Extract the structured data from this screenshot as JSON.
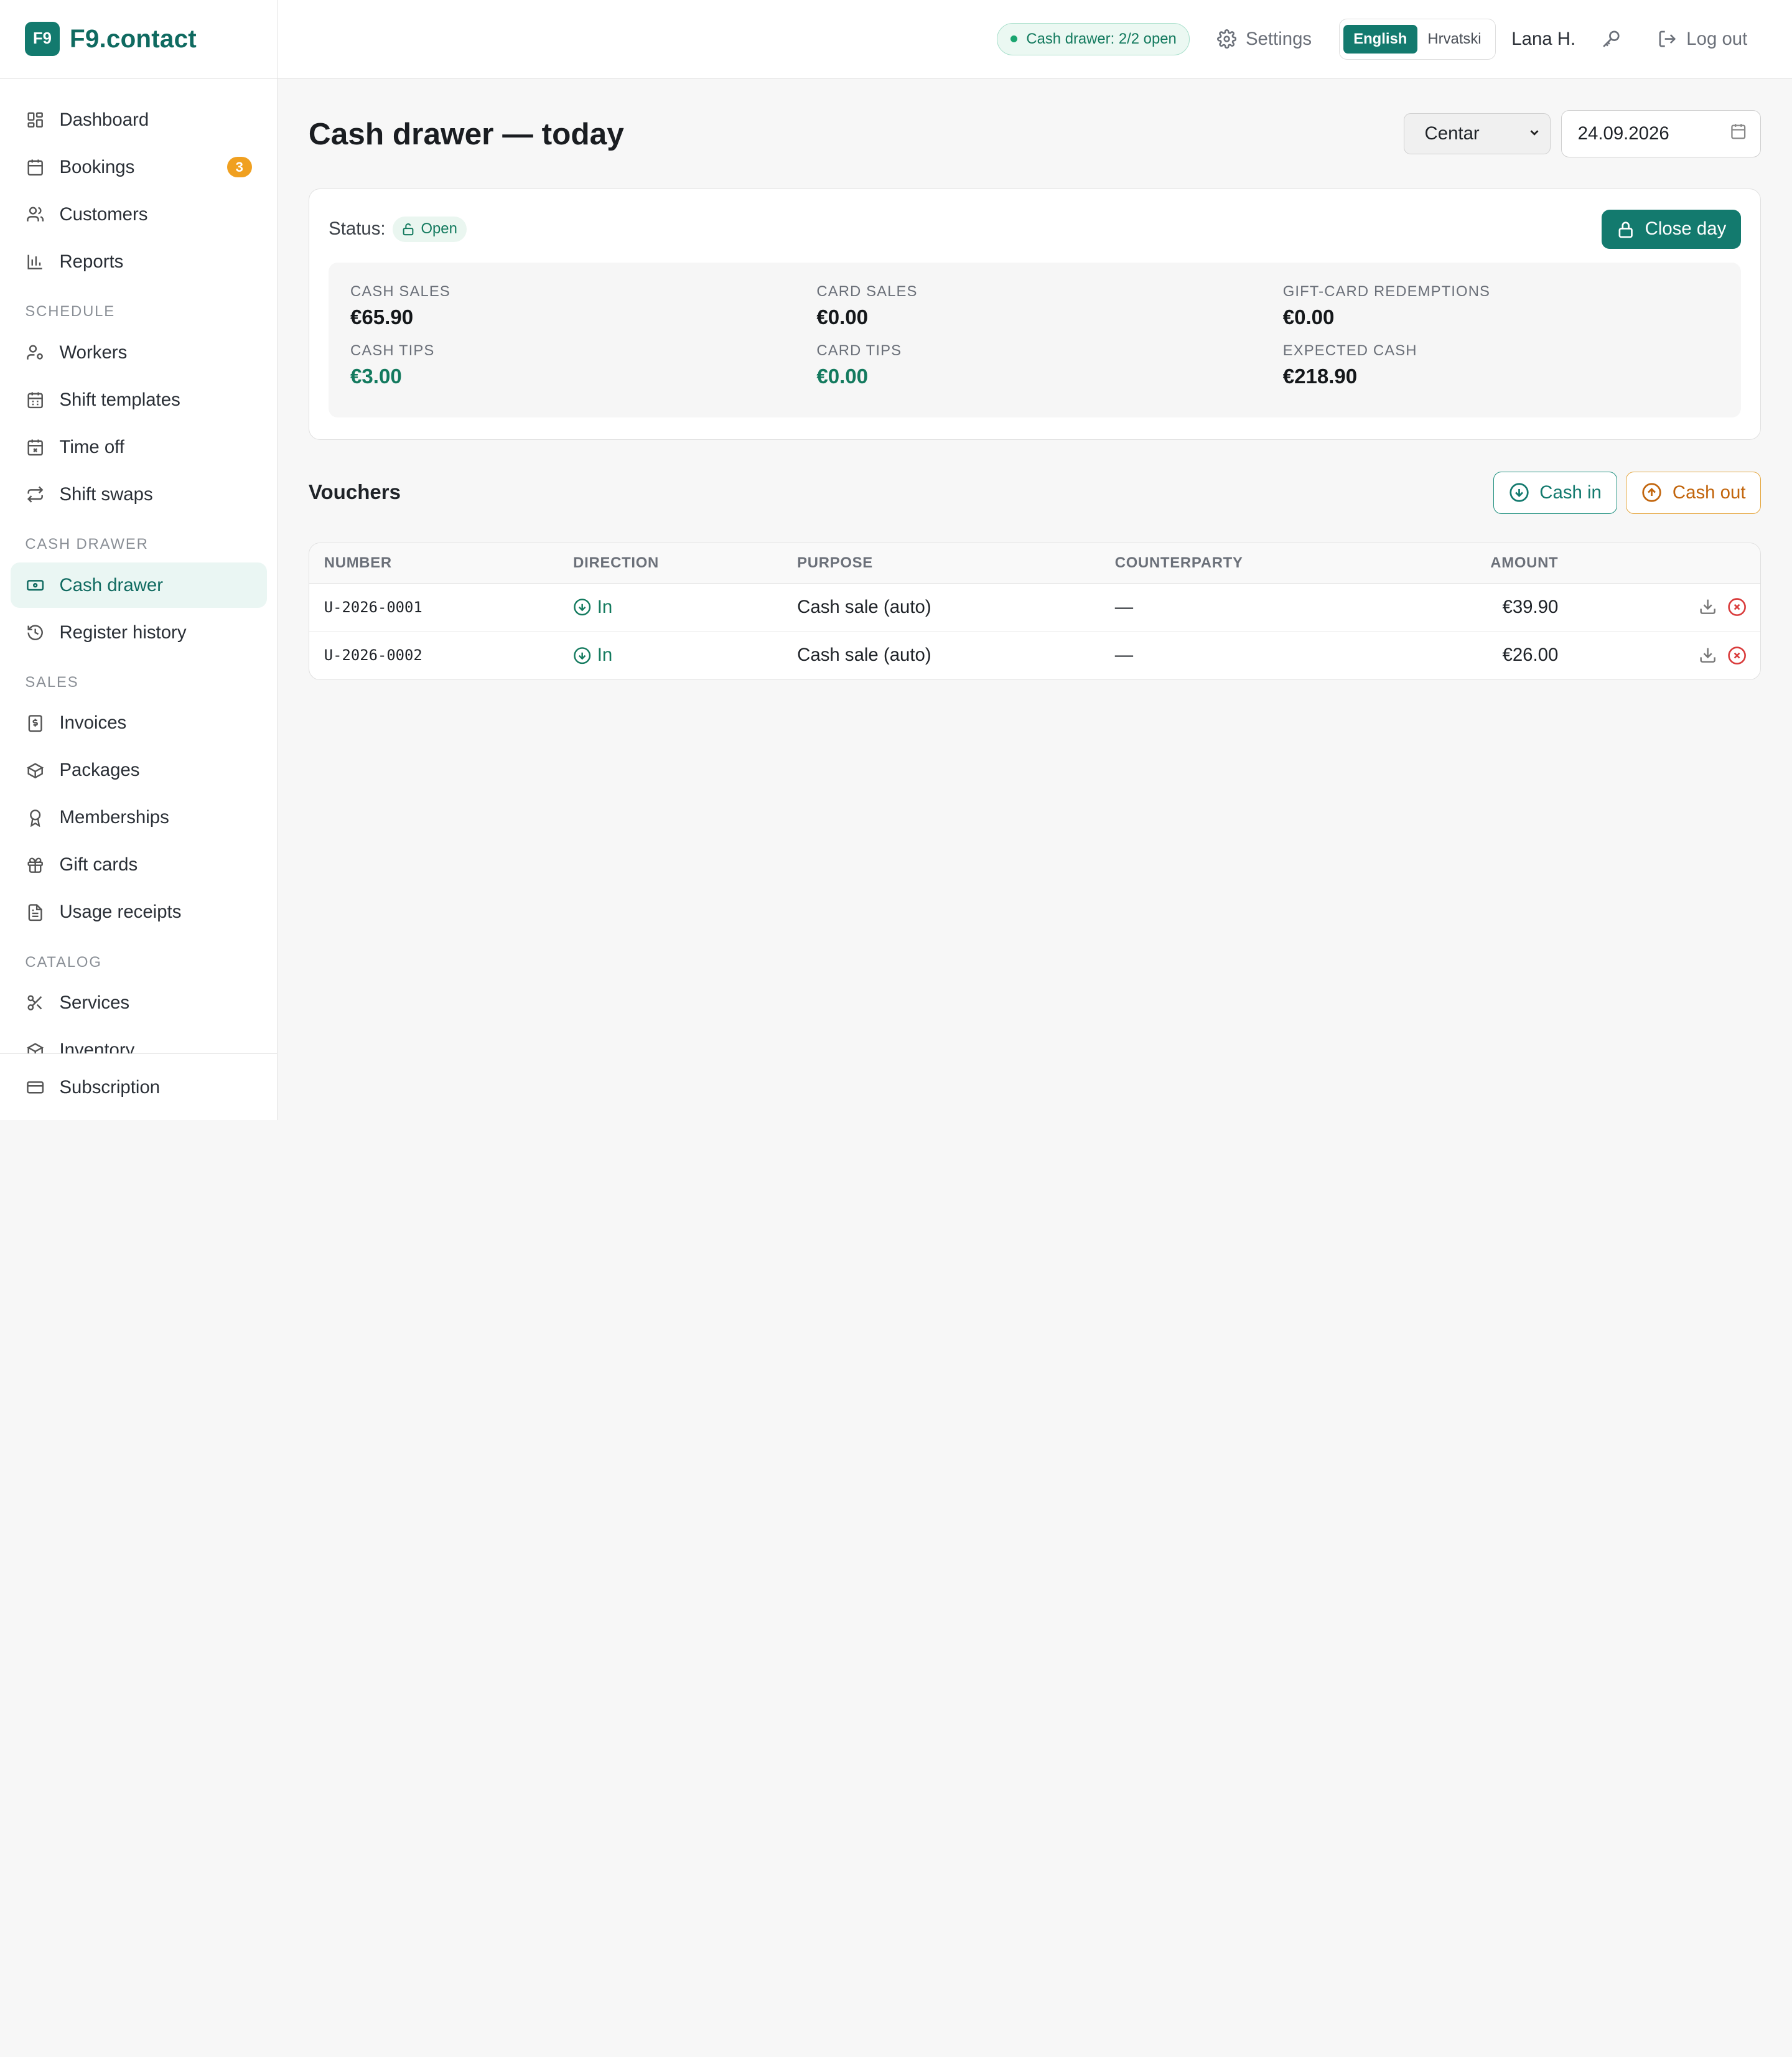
{
  "brand": {
    "logo": "F9",
    "name": "F9.contact"
  },
  "sidebar": {
    "primary": [
      {
        "label": "Dashboard",
        "icon": "dashboard-icon"
      },
      {
        "label": "Bookings",
        "icon": "calendar-icon",
        "badge": "3"
      },
      {
        "label": "Customers",
        "icon": "users-icon"
      },
      {
        "label": "Reports",
        "icon": "bar-chart-icon"
      }
    ],
    "schedule_title": "SCHEDULE",
    "schedule": [
      {
        "label": "Workers",
        "icon": "user-cog-icon"
      },
      {
        "label": "Shift templates",
        "icon": "calendar-icon"
      },
      {
        "label": "Time off",
        "icon": "calendar-x-icon"
      },
      {
        "label": "Shift swaps",
        "icon": "repeat-icon"
      }
    ],
    "cash_title": "CASH DRAWER",
    "cash": [
      {
        "label": "Cash drawer",
        "icon": "banknote-icon",
        "active": true
      },
      {
        "label": "Register history",
        "icon": "history-icon"
      }
    ],
    "sales_title": "SALES",
    "sales": [
      {
        "label": "Invoices",
        "icon": "receipt-dollar-icon"
      },
      {
        "label": "Packages",
        "icon": "package-icon"
      },
      {
        "label": "Memberships",
        "icon": "award-icon"
      },
      {
        "label": "Gift cards",
        "icon": "gift-icon"
      },
      {
        "label": "Usage receipts",
        "icon": "file-text-icon"
      }
    ],
    "catalog_title": "CATALOG",
    "catalog": [
      {
        "label": "Services",
        "icon": "scissors-icon"
      },
      {
        "label": "Inventory",
        "icon": "box-icon"
      }
    ],
    "footer": {
      "label": "Subscription",
      "icon": "credit-card-icon"
    }
  },
  "topbar": {
    "drawer_status": "Cash drawer: 2/2 open",
    "settings": "Settings",
    "lang_en": "English",
    "lang_hr": "Hrvatski",
    "user": "Lana H.",
    "logout": "Log out"
  },
  "page": {
    "title": "Cash drawer — today",
    "location": "Centar",
    "date": "24.09.2026"
  },
  "summary": {
    "status_label": "Status:",
    "status_value": "Open",
    "close_button": "Close day",
    "cash_sales_label": "CASH SALES",
    "cash_sales": "€65.90",
    "card_sales_label": "CARD SALES",
    "card_sales": "€0.00",
    "giftcard_label": "GIFT-CARD REDEMPTIONS",
    "giftcard": "€0.00",
    "cash_tips_label": "CASH TIPS",
    "cash_tips": "€3.00",
    "card_tips_label": "CARD TIPS",
    "card_tips": "€0.00",
    "expected_label": "EXPECTED CASH",
    "expected": "€218.90"
  },
  "vouchers": {
    "title": "Vouchers",
    "cash_in": "Cash in",
    "cash_out": "Cash out",
    "columns": [
      "NUMBER",
      "DIRECTION",
      "PURPOSE",
      "COUNTERPARTY",
      "AMOUNT"
    ],
    "rows": [
      {
        "number": "U-2026-0001",
        "direction": "In",
        "purpose": "Cash sale (auto)",
        "counterparty": "—",
        "amount": "€39.90"
      },
      {
        "number": "U-2026-0002",
        "direction": "In",
        "purpose": "Cash sale (auto)",
        "counterparty": "—",
        "amount": "€26.00"
      }
    ]
  },
  "colors": {
    "accent": "#137a6e",
    "warning": "#e4a53c",
    "danger": "#d93b3b",
    "badge": "#f0a020"
  }
}
